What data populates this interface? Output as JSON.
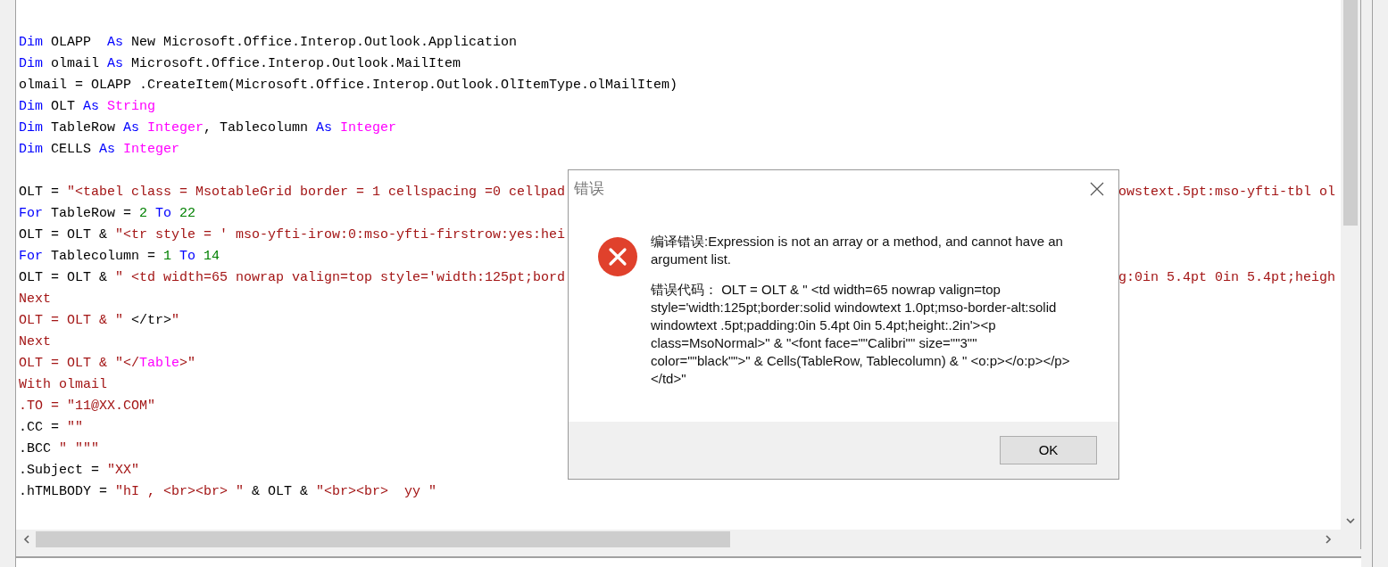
{
  "editor": {
    "lines": [
      {
        "kind": "code",
        "segments": [
          {
            "kind": "keyword",
            "text": "Dim"
          },
          {
            "kind": "plain",
            "text": " OLAPP  "
          },
          {
            "kind": "keyword",
            "text": "As"
          },
          {
            "kind": "plain",
            "text": " New Microsoft.Office.Interop.Outlook.Application"
          }
        ]
      },
      {
        "kind": "code",
        "segments": [
          {
            "kind": "keyword",
            "text": "Dim"
          },
          {
            "kind": "plain",
            "text": " olmail "
          },
          {
            "kind": "keyword",
            "text": "As"
          },
          {
            "kind": "plain",
            "text": " Microsoft.Office.Interop.Outlook.MailItem"
          }
        ]
      },
      {
        "kind": "code",
        "segments": [
          {
            "kind": "plain",
            "text": "olmail = OLAPP .CreateItem(Microsoft.Office.Interop.Outlook.OlItemType.olMailItem)"
          }
        ]
      },
      {
        "kind": "code",
        "segments": [
          {
            "kind": "keyword",
            "text": "Dim"
          },
          {
            "kind": "plain",
            "text": " OLT "
          },
          {
            "kind": "keyword",
            "text": "As "
          },
          {
            "kind": "type",
            "text": "String"
          }
        ]
      },
      {
        "kind": "code",
        "segments": [
          {
            "kind": "keyword",
            "text": "Dim"
          },
          {
            "kind": "plain",
            "text": " TableRow "
          },
          {
            "kind": "keyword",
            "text": "As "
          },
          {
            "kind": "type",
            "text": "Integer"
          },
          {
            "kind": "plain",
            "text": ", Tablecolumn "
          },
          {
            "kind": "keyword",
            "text": "As "
          },
          {
            "kind": "type",
            "text": "Integer"
          }
        ]
      },
      {
        "kind": "code",
        "segments": [
          {
            "kind": "keyword",
            "text": "Dim"
          },
          {
            "kind": "plain",
            "text": " CELLS "
          },
          {
            "kind": "keyword",
            "text": "As "
          },
          {
            "kind": "type",
            "text": "Integer"
          }
        ]
      },
      {
        "kind": "blank"
      },
      {
        "kind": "code",
        "segments": [
          {
            "kind": "plain",
            "text": "OLT = "
          },
          {
            "kind": "string",
            "text": "\"<tabel class = MsotableGrid border = 1 cellspacing =0 cellpad"
          }
        ],
        "right_segments": [
          {
            "kind": "string",
            "text": "owstext.5pt:mso-yfti-tbl ol"
          }
        ]
      },
      {
        "kind": "code",
        "segments": [
          {
            "kind": "keyword",
            "text": "For"
          },
          {
            "kind": "plain",
            "text": " TableRow = "
          },
          {
            "kind": "number",
            "text": "2"
          },
          {
            "kind": "keyword",
            "text": " To "
          },
          {
            "kind": "number",
            "text": "22"
          }
        ]
      },
      {
        "kind": "code",
        "segments": [
          {
            "kind": "plain",
            "text": "OLT = OLT & "
          },
          {
            "kind": "string",
            "text": "\"<tr style = ' mso-yfti-irow:0:mso-yfti-firstrow:yes:hei"
          }
        ]
      },
      {
        "kind": "code",
        "segments": [
          {
            "kind": "keyword",
            "text": "For"
          },
          {
            "kind": "plain",
            "text": " Tablecolumn = "
          },
          {
            "kind": "number",
            "text": "1"
          },
          {
            "kind": "keyword",
            "text": " To "
          },
          {
            "kind": "number",
            "text": "14"
          }
        ]
      },
      {
        "kind": "code",
        "segments": [
          {
            "kind": "plain",
            "text": "OLT = OLT & "
          },
          {
            "kind": "string",
            "text": "\" <td width=65 nowrap valign=top style='width:125pt;bord"
          }
        ],
        "right_segments": [
          {
            "kind": "string",
            "text": "g:0in 5.4pt 0in 5.4pt;heigh"
          }
        ]
      },
      {
        "kind": "code",
        "segments": [
          {
            "kind": "string",
            "text": "Next"
          }
        ]
      },
      {
        "kind": "code",
        "segments": [
          {
            "kind": "string",
            "text": "OLT = OLT & \" "
          },
          {
            "kind": "plain",
            "text": "</tr>"
          },
          {
            "kind": "string",
            "text": "\""
          }
        ]
      },
      {
        "kind": "code",
        "segments": [
          {
            "kind": "string",
            "text": "Next"
          }
        ]
      },
      {
        "kind": "code",
        "segments": [
          {
            "kind": "string",
            "text": "OLT = OLT & \"</"
          },
          {
            "kind": "type",
            "text": "Table"
          },
          {
            "kind": "string",
            "text": ">\""
          }
        ]
      },
      {
        "kind": "code",
        "segments": [
          {
            "kind": "string",
            "text": "With olmail"
          }
        ]
      },
      {
        "kind": "code",
        "segments": [
          {
            "kind": "string",
            "text": ".TO = \"11@XX.COM\""
          }
        ]
      },
      {
        "kind": "code",
        "segments": [
          {
            "kind": "plain",
            "text": ".CC = "
          },
          {
            "kind": "string",
            "text": "\"\""
          }
        ]
      },
      {
        "kind": "code",
        "segments": [
          {
            "kind": "plain",
            "text": ".BCC "
          },
          {
            "kind": "string",
            "text": "\" \"\"\""
          }
        ]
      },
      {
        "kind": "code",
        "segments": [
          {
            "kind": "plain",
            "text": ".Subject = "
          },
          {
            "kind": "string",
            "text": "\"XX\""
          }
        ]
      },
      {
        "kind": "code",
        "segments": [
          {
            "kind": "plain",
            "text": ".hTMLBODY = "
          },
          {
            "kind": "string",
            "text": "\"hI , <br><br> \""
          },
          {
            "kind": "plain",
            "text": " & OLT & "
          },
          {
            "kind": "string",
            "text": "\"<br><br>  yy \""
          }
        ]
      }
    ]
  },
  "dialog": {
    "title": "错误",
    "message": "编译错误:Expression is not an array or a method, and cannot have an argument list.",
    "code": "错误代码： OLT = OLT & \" <td width=65 nowrap valign=top style='width:125pt;border:solid windowtext 1.0pt;mso-border-alt:solid windowtext .5pt;padding:0in 5.4pt 0in 5.4pt;height:.2in'><p class=MsoNormal>\" & \"<font face=\"\"Calibri\"\" size=\"\"3\"\" color=\"\"black\"\">\" & Cells(TableRow, Tablecolumn) & \" <o:p></o:p></p></td>\"",
    "button": "OK"
  }
}
